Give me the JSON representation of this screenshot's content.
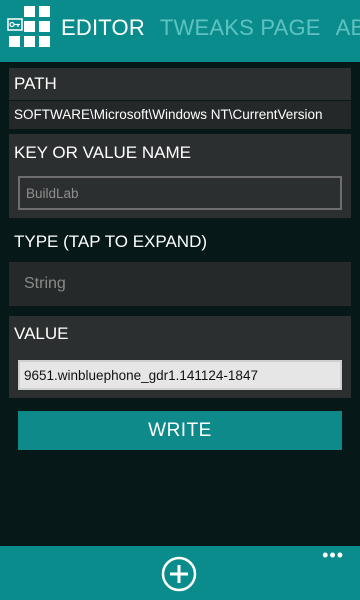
{
  "pivot": {
    "tabs": [
      "EDITOR",
      "TWEAKS PAGE",
      "ABOUT"
    ]
  },
  "form": {
    "path_label": "PATH",
    "path_value": "SOFTWARE\\Microsoft\\Windows NT\\CurrentVersion",
    "key_label": "KEY OR VALUE NAME",
    "key_value": "BuildLab",
    "type_label": "TYPE (TAP TO EXPAND)",
    "type_value": "String",
    "value_label": "VALUE",
    "value_value": "9651.winbluephone_gdr1.141124-1847",
    "write_label": "WRITE"
  },
  "appbar": {
    "add_icon": "add-circle-icon",
    "more_label": "•••"
  },
  "colors": {
    "accent": "#0b8c8c",
    "background": "#061818",
    "panel": "#2c2f2f",
    "inactive_tab": "#5fc2c2"
  }
}
